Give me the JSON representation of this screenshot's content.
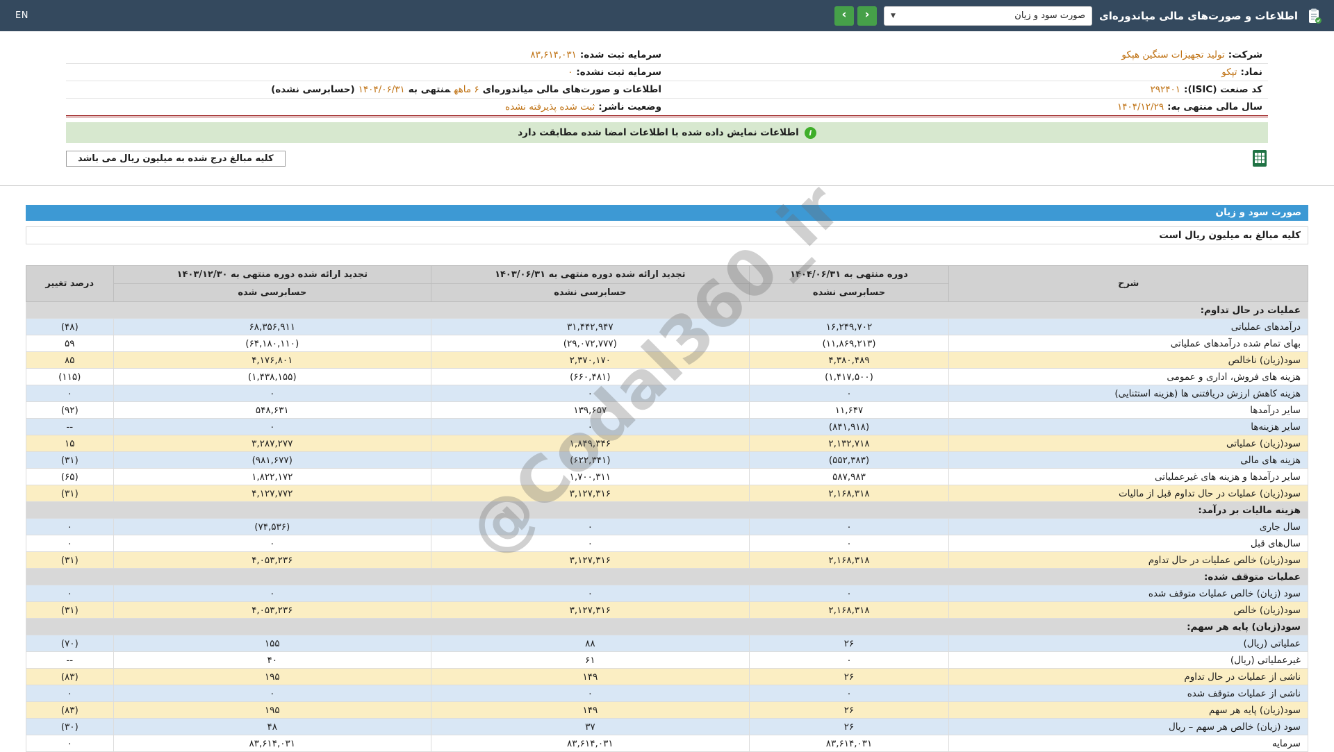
{
  "colors": {
    "bar": "#34495e",
    "green": "#46a049",
    "blue-bar": "#3d99d4",
    "row-blue": "#d9e7f5",
    "row-yellow": "#fbeec3",
    "row-gray": "#d8d8d8",
    "header-gray": "#d2d2d2",
    "neg": "#c3201f",
    "value-orange": "#bf7112",
    "banner-bg": "#d7e8cf",
    "banner-icon": "#3fae2a",
    "red-line": "#9b1c1c"
  },
  "header": {
    "en_label": "EN",
    "title": "اطلاعات و صورت‌های مالی میاندوره‌ای",
    "dropdown_value": "صورت سود و زیان",
    "caret": "▼",
    "nav_prev": "‹",
    "nav_next": "›"
  },
  "company_info": {
    "right_rows": [
      [
        {
          "t": "شرکت:",
          "c": "label"
        },
        {
          "t": "تولید تجهیزات سنگین هپکو",
          "c": "value"
        }
      ],
      [
        {
          "t": "نماد:",
          "c": "label"
        },
        {
          "t": "تپکو",
          "c": "value"
        }
      ],
      [
        {
          "t": "کد صنعت (ISIC):",
          "c": "label"
        },
        {
          "t": "۲۹۲۴۰۱",
          "c": "value"
        }
      ],
      [
        {
          "t": "سال مالی منتهی به:",
          "c": "label"
        },
        {
          "t": "۱۴۰۴/۱۲/۲۹",
          "c": "value"
        }
      ]
    ],
    "left_rows": [
      [
        {
          "t": "سرمایه ثبت شده:",
          "c": "label"
        },
        {
          "t": "۸۳,۶۱۴,۰۳۱",
          "c": "value"
        }
      ],
      [
        {
          "t": "سرمایه ثبت نشده:",
          "c": "label"
        },
        {
          "t": "۰",
          "c": "value"
        }
      ],
      [
        {
          "t": "اطلاعات و صورت‌های مالی میاندوره‌ای",
          "c": "label"
        },
        {
          "t": "۶ ماهه",
          "c": "value"
        },
        {
          "t": "منتهی به",
          "c": "label"
        },
        {
          "t": "۱۴۰۴/۰۶/۳۱",
          "c": "value"
        },
        {
          "t": "(حسابرسی نشده)",
          "c": "label"
        }
      ],
      [
        {
          "t": "وضعیت ناشر:",
          "c": "label"
        },
        {
          "t": "ثبت شده پذیرفته نشده",
          "c": "value"
        }
      ]
    ]
  },
  "banner": {
    "icon_glyph": "i",
    "text": "اطلاعات نمایش داده شده با اطلاعات امضا شده مطابقت دارد"
  },
  "notes": {
    "box_text": "کلیه مبالغ درج شده به میلیون ریال می باشد"
  },
  "watermark": {
    "text": "@Codal360_ir"
  },
  "table": {
    "title": "صورت سود و زیان",
    "amounts_note": "کلیه مبالغ به میلیون ریال است",
    "headers": {
      "desc": "شرح",
      "period_current": "دوره منتهی به ۱۴۰۴/۰۶/۳۱",
      "period_prev": "تجدید ارائه شده دوره منتهی به ۱۴۰۳/۰۶/۳۱",
      "period_year": "تجدید ارائه شده دوره منتهی به ۱۴۰۳/۱۲/۳۰",
      "change": "درصد تغییر",
      "audited_no1": "حسابرسی نشده",
      "audited_no2": "حسابرسی نشده",
      "audited_yes": "حسابرسی شده"
    },
    "rows": [
      {
        "type": "section",
        "label": "عملیات در حال تداوم:"
      },
      {
        "type": "blue",
        "label": "درآمدهای عملیاتی",
        "values": [
          "۱۶,۲۴۹,۷۰۲",
          "۳۱,۴۴۲,۹۴۷",
          "۶۸,۳۵۶,۹۱۱",
          "(۴۸)"
        ]
      },
      {
        "type": "white",
        "label": "بهای تمام شده درآمدهای عملیاتی",
        "values": [
          "(۱۱,۸۶۹,۲۱۳)",
          "(۲۹,۰۷۲,۷۷۷)",
          "(۶۴,۱۸۰,۱۱۰)",
          "۵۹"
        ]
      },
      {
        "type": "highlight",
        "label": "سود(زیان) ناخالص",
        "values": [
          "۴,۳۸۰,۴۸۹",
          "۲,۳۷۰,۱۷۰",
          "۴,۱۷۶,۸۰۱",
          "۸۵"
        ]
      },
      {
        "type": "white",
        "label": "هزینه های فروش، اداری و عمومی",
        "values": [
          "(۱,۴۱۷,۵۰۰)",
          "(۶۶۰,۴۸۱)",
          "(۱,۴۳۸,۱۵۵)",
          "(۱۱۵)"
        ]
      },
      {
        "type": "blue",
        "label": "هزینه کاهش ارزش دریافتنی ها (هزینه استثنایی)",
        "values": [
          "۰",
          "۰",
          "۰",
          "۰"
        ]
      },
      {
        "type": "white",
        "label": "سایر درآمدها",
        "values": [
          "۱۱,۶۴۷",
          "۱۳۹,۶۵۷",
          "۵۴۸,۶۳۱",
          "(۹۲)"
        ]
      },
      {
        "type": "blue",
        "label": "سایر هزینه‌ها",
        "values": [
          "(۸۴۱,۹۱۸)",
          "۰",
          "۰",
          "--"
        ]
      },
      {
        "type": "highlight",
        "label": "سود(زیان) عملیاتی",
        "values": [
          "۲,۱۳۲,۷۱۸",
          "۱,۸۴۹,۳۴۶",
          "۳,۲۸۷,۲۷۷",
          "۱۵"
        ]
      },
      {
        "type": "blue",
        "label": "هزینه های مالی",
        "values": [
          "(۵۵۲,۳۸۳)",
          "(۶۲۲,۳۴۱)",
          "(۹۸۱,۶۷۷)",
          "(۳۱)"
        ]
      },
      {
        "type": "white",
        "label": "سایر درآمدها و هزینه های غیرعملیاتی",
        "values": [
          "۵۸۷,۹۸۳",
          "۱,۷۰۰,۳۱۱",
          "۱,۸۲۲,۱۷۲",
          "(۶۵)"
        ]
      },
      {
        "type": "highlight",
        "label": "سود(زیان) عملیات در حال تداوم قبل از مالیات",
        "values": [
          "۲,۱۶۸,۳۱۸",
          "۳,۱۲۷,۳۱۶",
          "۴,۱۲۷,۷۷۲",
          "(۳۱)"
        ]
      },
      {
        "type": "section",
        "label": "هزینه مالیات بر درآمد:"
      },
      {
        "type": "blue",
        "label": "سال جاری",
        "values": [
          "۰",
          "۰",
          "(۷۴,۵۳۶)",
          "۰"
        ]
      },
      {
        "type": "white",
        "label": "سال‌های قبل",
        "values": [
          "۰",
          "۰",
          "۰",
          "۰"
        ]
      },
      {
        "type": "highlight",
        "label": "سود(زیان) خالص عملیات در حال تداوم",
        "values": [
          "۲,۱۶۸,۳۱۸",
          "۳,۱۲۷,۳۱۶",
          "۴,۰۵۳,۲۳۶",
          "(۳۱)"
        ]
      },
      {
        "type": "section",
        "label": "عملیات متوقف شده:"
      },
      {
        "type": "blue",
        "label": "سود (زیان) خالص عملیات متوقف شده",
        "values": [
          "۰",
          "۰",
          "۰",
          "۰"
        ]
      },
      {
        "type": "highlight",
        "label": "سود(زیان) خالص",
        "values": [
          "۲,۱۶۸,۳۱۸",
          "۳,۱۲۷,۳۱۶",
          "۴,۰۵۳,۲۳۶",
          "(۳۱)"
        ]
      },
      {
        "type": "section",
        "label": "سود(زیان) پایه هر سهم:"
      },
      {
        "type": "blue",
        "label": "عملیاتی (ریال)",
        "values": [
          "۲۶",
          "۸۸",
          "۱۵۵",
          "(۷۰)"
        ]
      },
      {
        "type": "white",
        "label": "غیرعملیاتی (ریال)",
        "values": [
          "۰",
          "۶۱",
          "۴۰",
          "--"
        ]
      },
      {
        "type": "highlight",
        "label": "ناشی از عملیات در حال تداوم",
        "values": [
          "۲۶",
          "۱۴۹",
          "۱۹۵",
          "(۸۳)"
        ]
      },
      {
        "type": "blue",
        "label": "ناشی از عملیات متوقف شده",
        "values": [
          "۰",
          "۰",
          "۰",
          "۰"
        ]
      },
      {
        "type": "highlight",
        "label": "سود(زیان) پایه هر سهم",
        "values": [
          "۲۶",
          "۱۴۹",
          "۱۹۵",
          "(۸۳)"
        ]
      },
      {
        "type": "blue",
        "label": "سود (زیان) خالص هر سهم – ریال",
        "values": [
          "۲۶",
          "۳۷",
          "۴۸",
          "(۳۰)"
        ]
      },
      {
        "type": "white",
        "label": "سرمایه",
        "values": [
          "۸۳,۶۱۴,۰۳۱",
          "۸۳,۶۱۴,۰۳۱",
          "۸۳,۶۱۴,۰۳۱",
          "۰"
        ]
      }
    ]
  }
}
